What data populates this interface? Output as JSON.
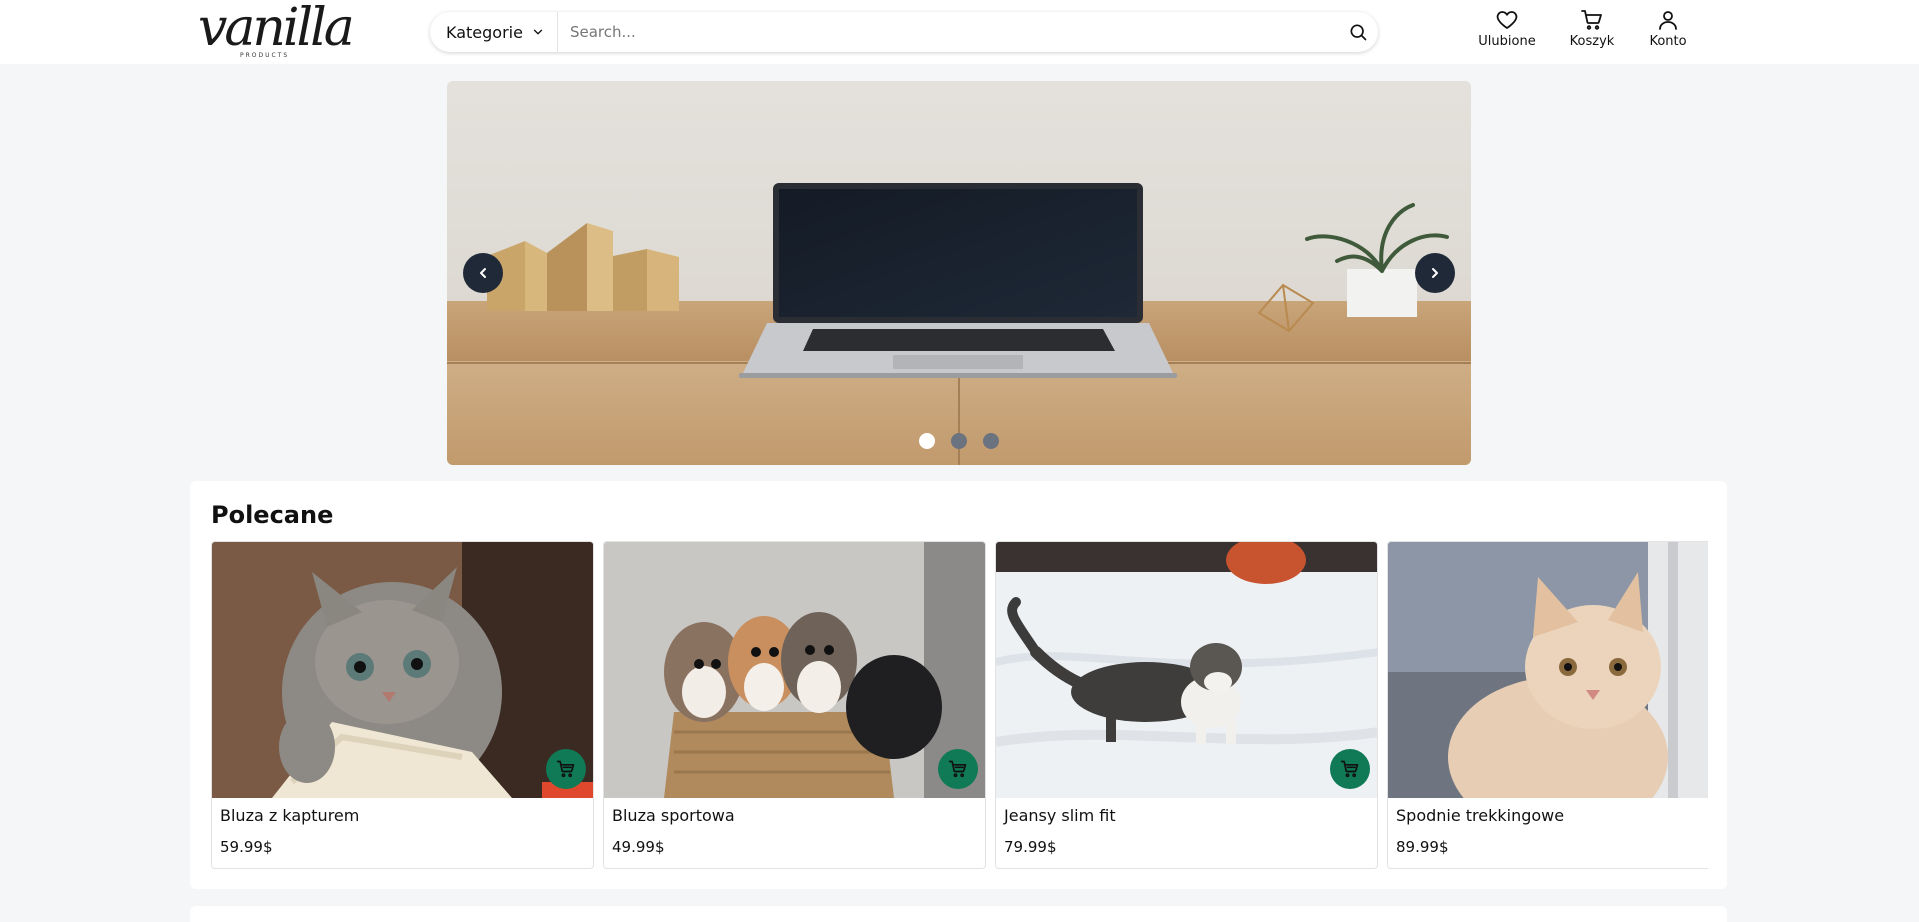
{
  "brand": {
    "name": "vanilla",
    "tagline": "PRODUCTS"
  },
  "search": {
    "category_label": "Kategorie",
    "placeholder": "Search..."
  },
  "nav": {
    "favorites": "Ulubione",
    "cart": "Koszyk",
    "account": "Konto"
  },
  "carousel": {
    "slide_count": 3,
    "active_index": 0
  },
  "featured": {
    "title": "Polecane",
    "products": [
      {
        "name": "Bluza z kapturem",
        "price": "59.99$",
        "image": "grey-kitten-photo"
      },
      {
        "name": "Bluza sportowa",
        "price": "49.99$",
        "image": "kittens-in-basket-photo"
      },
      {
        "name": "Jeansy slim fit",
        "price": "79.99$",
        "image": "cat-in-snow-photo"
      },
      {
        "name": "Spodnie trekkingowe",
        "price": "89.99$",
        "image": "ginger-kitten-photo"
      }
    ]
  },
  "colors": {
    "accent": "#0f7a55",
    "carousel_button": "#1f2937",
    "background": "#f5f6f7"
  }
}
